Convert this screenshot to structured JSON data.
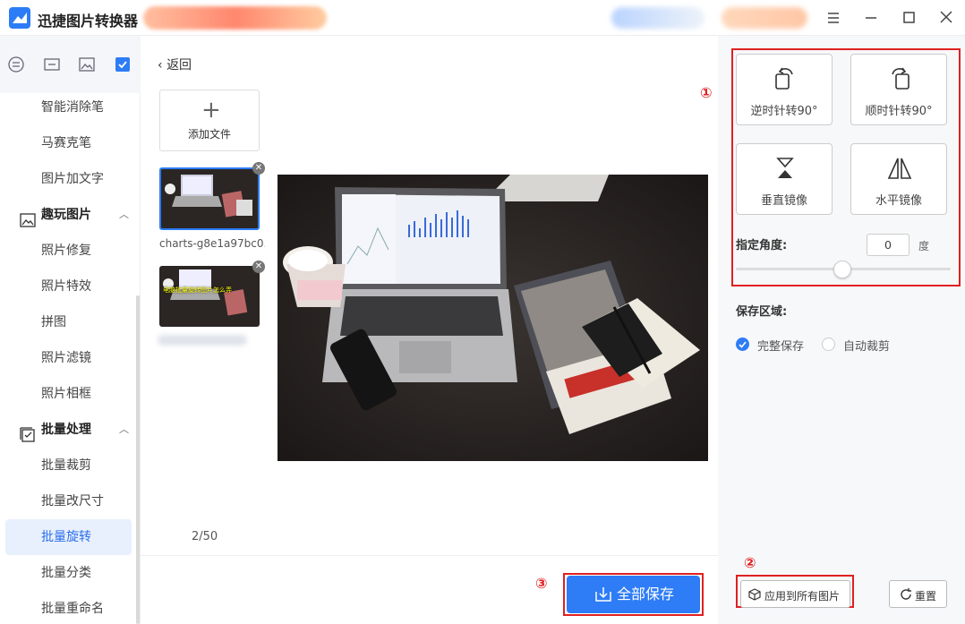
{
  "app": {
    "title": "迅捷图片转换器"
  },
  "sidebar": {
    "items_top": [
      "智能消除笔",
      "马赛克笔",
      "图片加文字"
    ],
    "group_fun": "趣玩图片",
    "items_fun": [
      "照片修复",
      "照片特效",
      "拼图",
      "照片滤镜",
      "照片相框"
    ],
    "group_batch": "批量处理",
    "items_batch": [
      "批量裁剪",
      "批量改尺寸",
      "批量旋转",
      "批量分类",
      "批量重命名"
    ],
    "active": "批量旋转"
  },
  "main": {
    "back": "返回",
    "add_file": "添加文件",
    "thumb1_caption": "charts-g8e1a97bc0...",
    "thumb2_text": "电脑批量旋转图片怎么弄",
    "page_count": "2/50",
    "save_all": "全部保存"
  },
  "right": {
    "rotate_ccw": "逆时针转90°",
    "rotate_cw": "顺时针转90°",
    "flip_v": "垂直镜像",
    "flip_h": "水平镜像",
    "angle_label": "指定角度:",
    "angle_value": "0",
    "degree_unit": "度",
    "save_area": "保存区域:",
    "opt_full": "完整保存",
    "opt_auto": "自动裁剪",
    "apply_all": "应用到所有图片",
    "reset": "重置"
  },
  "annotations": {
    "n1": "①",
    "n2": "②",
    "n3": "③"
  },
  "colors": {
    "accent": "#2e7cf6",
    "annotation": "#e02020"
  }
}
